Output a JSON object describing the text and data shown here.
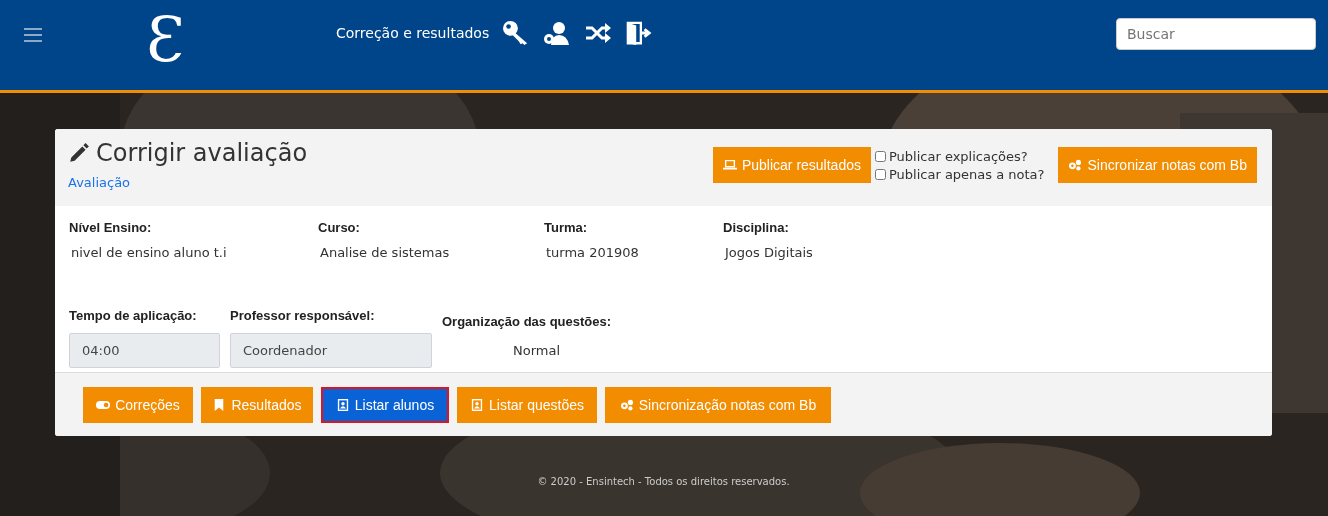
{
  "header": {
    "logo": "Ɛ",
    "nav_title": "Correção e resultados",
    "search": {
      "placeholder": "Buscar"
    }
  },
  "card": {
    "title": "Corrigir avaliação",
    "subtitle": "Avaliação",
    "publish_button": "Publicar resultados",
    "options": [
      {
        "label": "Publicar explicações?",
        "checked": false
      },
      {
        "label": "Publicar apenas a nota?",
        "checked": false
      }
    ],
    "sync_button": "Sincronizar notas com Bb",
    "info": [
      {
        "label": "Nível Ensino:",
        "value": "nivel de ensino aluno t.i"
      },
      {
        "label": "Curso:",
        "value": "Analise de sistemas"
      },
      {
        "label": "Turma:",
        "value": "turma 201908"
      },
      {
        "label": "Disciplina:",
        "value": "Jogos Digitais"
      }
    ],
    "time": {
      "label": "Tempo de aplicação:",
      "value": "04:00"
    },
    "teacher": {
      "label": "Professor responsável:",
      "value": "Coordenador"
    },
    "order": {
      "label": "Organização das questões:",
      "value": "Normal"
    },
    "actions": [
      {
        "label": "Correções",
        "kind": "toggle",
        "selected": false
      },
      {
        "label": "Resultados",
        "kind": "bookmark",
        "selected": false
      },
      {
        "label": "Listar alunos",
        "kind": "contact",
        "selected": true
      },
      {
        "label": "Listar questões",
        "kind": "contact",
        "selected": false
      },
      {
        "label": "Sincronização notas com Bb",
        "kind": "gears",
        "selected": false
      }
    ]
  },
  "footer": "© 2020 - Ensintech - Todos os direitos reservados."
}
